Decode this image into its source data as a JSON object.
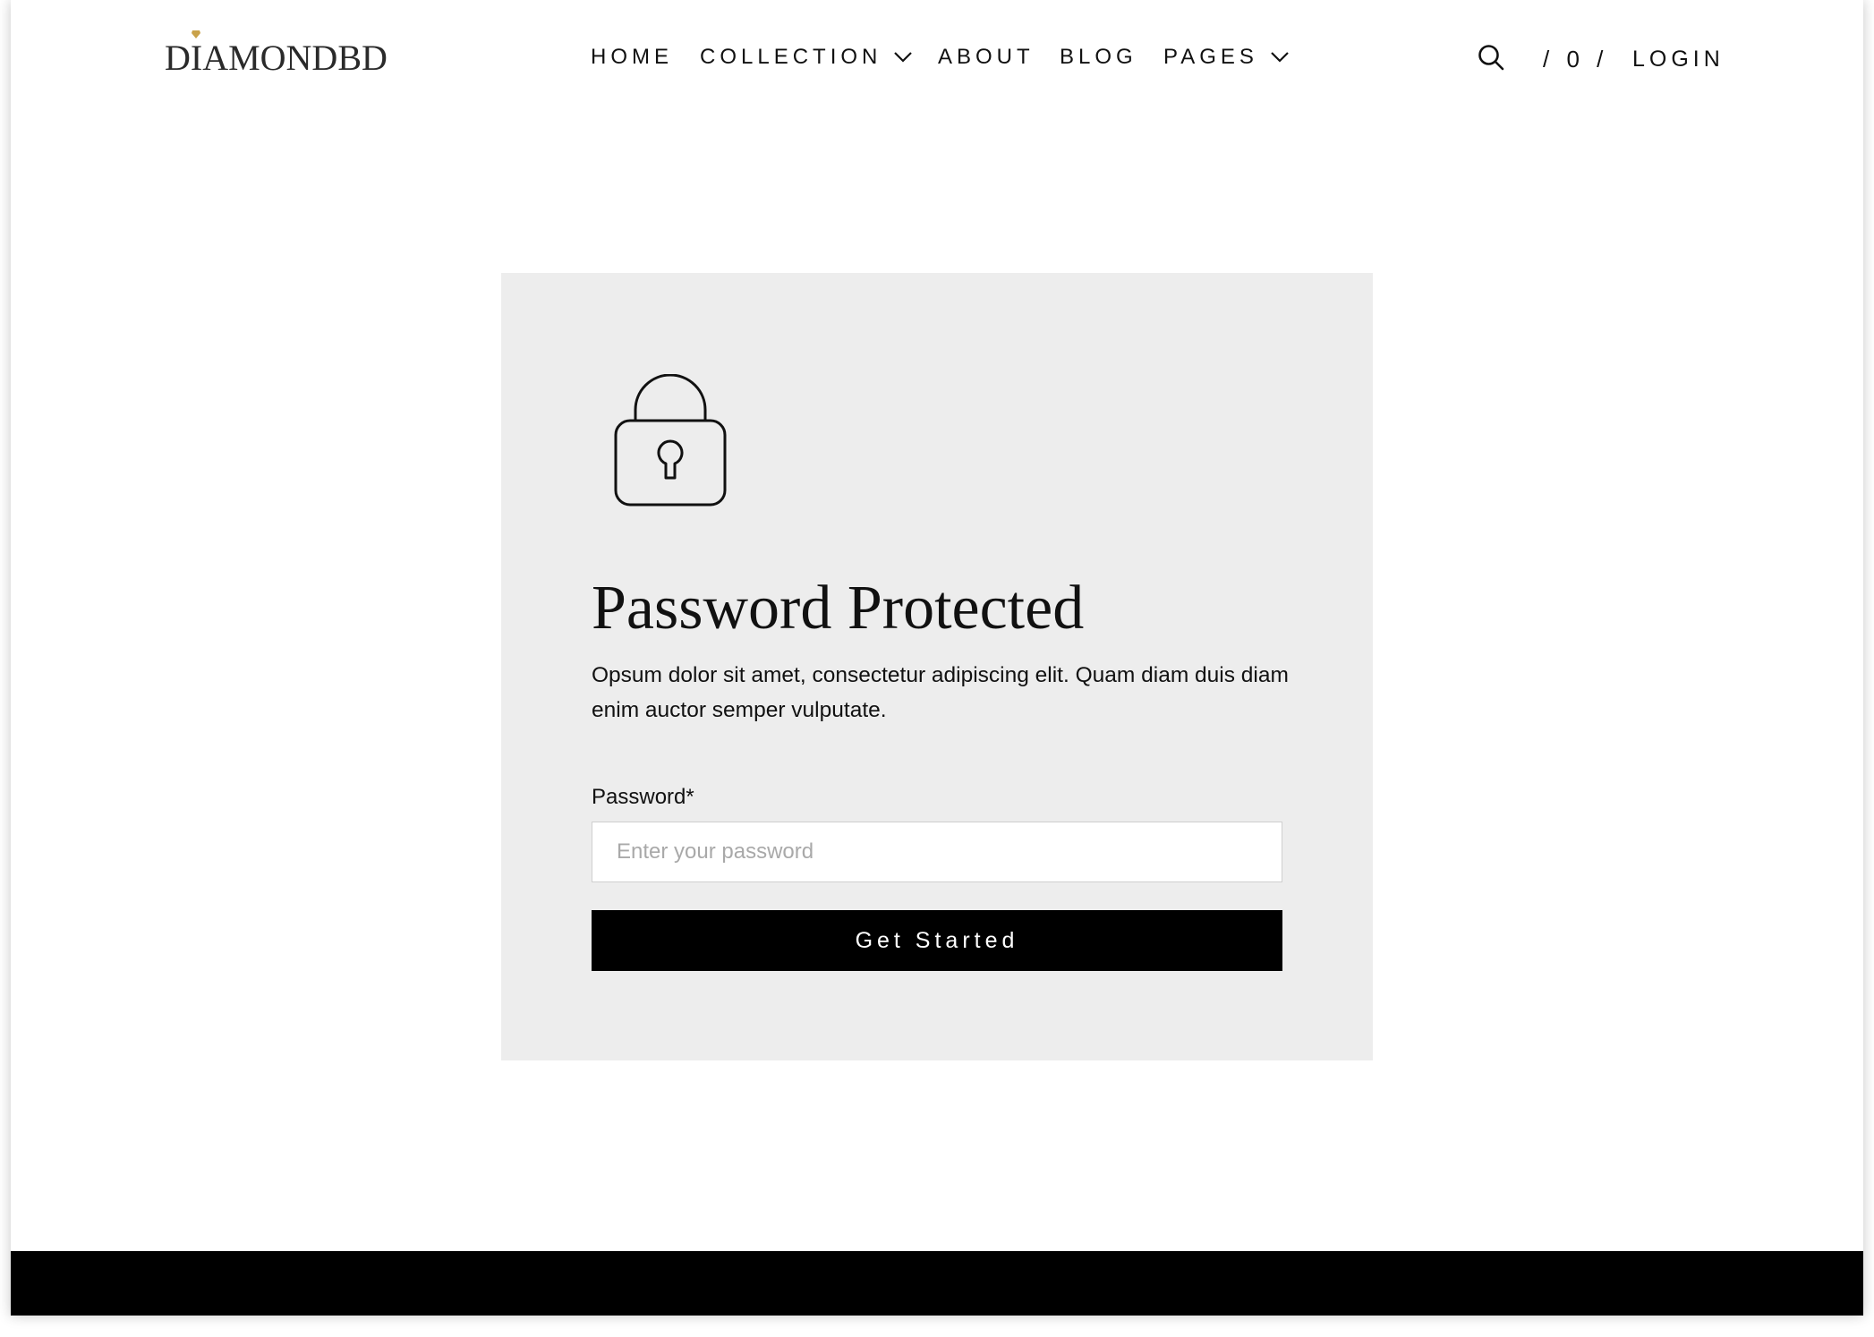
{
  "brand": {
    "logo_text": "DIAMONDBD",
    "accent_color": "#c9a24a"
  },
  "nav": {
    "items": [
      {
        "label": "HOME",
        "has_dropdown": false
      },
      {
        "label": "COLLECTION",
        "has_dropdown": true
      },
      {
        "label": "ABOUT",
        "has_dropdown": false
      },
      {
        "label": "BLOG",
        "has_dropdown": false
      },
      {
        "label": "PAGES",
        "has_dropdown": true
      }
    ]
  },
  "header_tools": {
    "search_icon": "search-icon",
    "cart_label": "/ 0 /",
    "login_label": "LOGIN"
  },
  "card": {
    "icon": "lock-icon",
    "title": "Password Protected",
    "description": "Opsum dolor sit amet, consectetur adipiscing elit. Quam diam duis diam enim auctor semper vulputate.",
    "password_label": "Password*",
    "password_placeholder": "Enter your password",
    "password_value": "",
    "submit_label": "Get Started",
    "background_color": "#ededed"
  },
  "footer": {
    "background_color": "#000000"
  }
}
